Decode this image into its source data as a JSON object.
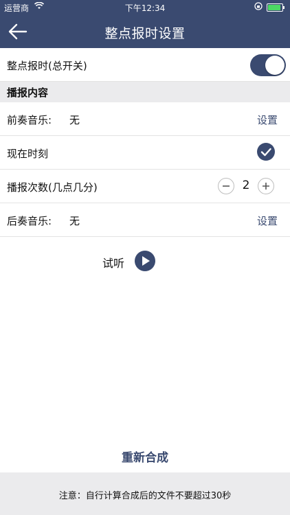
{
  "status_bar": {
    "carrier": "运营商",
    "time": "下午12:34"
  },
  "nav": {
    "title": "整点报时设置"
  },
  "master_toggle": {
    "label": "整点报时(总开关)",
    "on": true
  },
  "section_title": "播报内容",
  "rows": {
    "prelude": {
      "label": "前奏音乐:",
      "value": "无",
      "action": "设置"
    },
    "current_time": {
      "label": "现在时刻",
      "checked": true
    },
    "repeat": {
      "label": "播报次数(几点几分)",
      "count": "2"
    },
    "postlude": {
      "label": "后奏音乐:",
      "value": "无",
      "action": "设置"
    }
  },
  "preview": {
    "label": "试听"
  },
  "resynthesize": "重新合成",
  "footer_note": "注意：自行计算合成后的文件不要超过30秒",
  "colors": {
    "accent": "#3a4a70",
    "section_bg": "#ebebed",
    "battery": "#4cd964"
  }
}
